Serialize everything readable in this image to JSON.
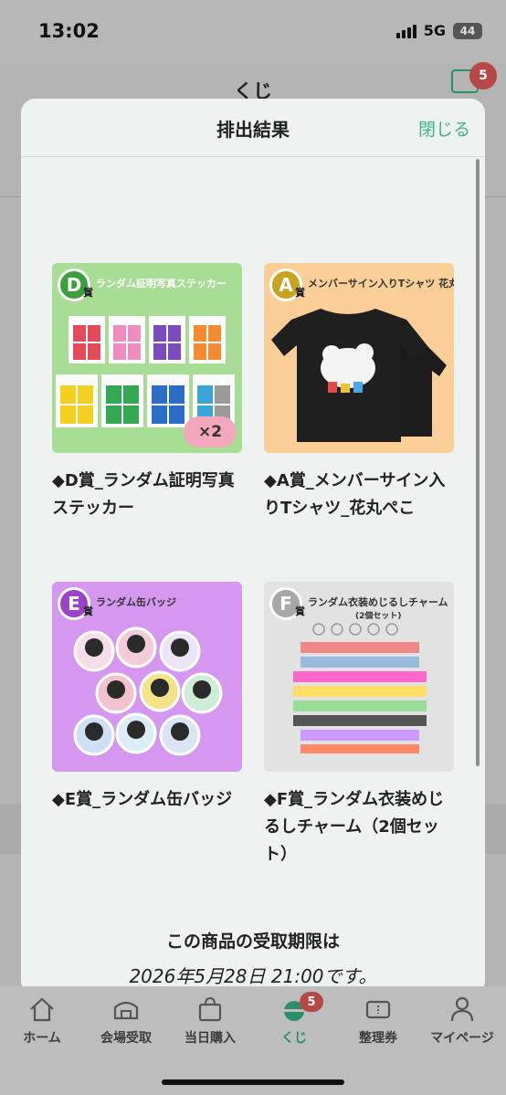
{
  "status_bar": {
    "time": "13:02",
    "network": "5G",
    "battery": "44"
  },
  "background": {
    "title": "くじ",
    "inbox_badge": "5"
  },
  "modal": {
    "title": "排出結果",
    "close_label": "閉じる",
    "items": [
      {
        "name": "◆D賞_ランダム証明写真ステッカー",
        "grade": "D",
        "grade_suffix": "賞",
        "banner": "ランダム証明写真ステッカー",
        "quantity": "×2",
        "bg": "#a8dd95",
        "grade_color": "#3ba03b"
      },
      {
        "name": "◆A賞_メンバーサイン入りTシャツ_花丸ぺこ",
        "grade": "A",
        "grade_suffix": "賞",
        "banner": "メンバーサイン入りTシャツ 花丸ぺこ",
        "bg": "#fbcf97",
        "grade_color": "#c9a21e"
      },
      {
        "name": "◆E賞_ランダム缶バッジ",
        "grade": "E",
        "grade_suffix": "賞",
        "banner": "ランダム缶バッジ",
        "bg": "#d597ef",
        "grade_color": "#9a43c8"
      },
      {
        "name": "◆F賞_ランダム衣装めじるしチャーム（2個セット）",
        "grade": "F",
        "grade_suffix": "賞",
        "banner": "ランダム衣装めじるしチャーム",
        "banner_sub": "(2個セット)",
        "bg": "#e2e2e2",
        "grade_color": "#a8a8a8"
      }
    ],
    "deadline_line1": "この商品の受取期限は",
    "deadline_line2": "2026年5月28日 21:00です。"
  },
  "tabbar": {
    "tabs": [
      {
        "label": "ホーム",
        "icon": "home-icon"
      },
      {
        "label": "会場受取",
        "icon": "venue-icon"
      },
      {
        "label": "当日購入",
        "icon": "shopping-bag-icon"
      },
      {
        "label": "くじ",
        "icon": "lottery-icon",
        "badge": "5",
        "active": true
      },
      {
        "label": "整理券",
        "icon": "ticket-icon"
      },
      {
        "label": "マイページ",
        "icon": "person-icon"
      }
    ]
  }
}
